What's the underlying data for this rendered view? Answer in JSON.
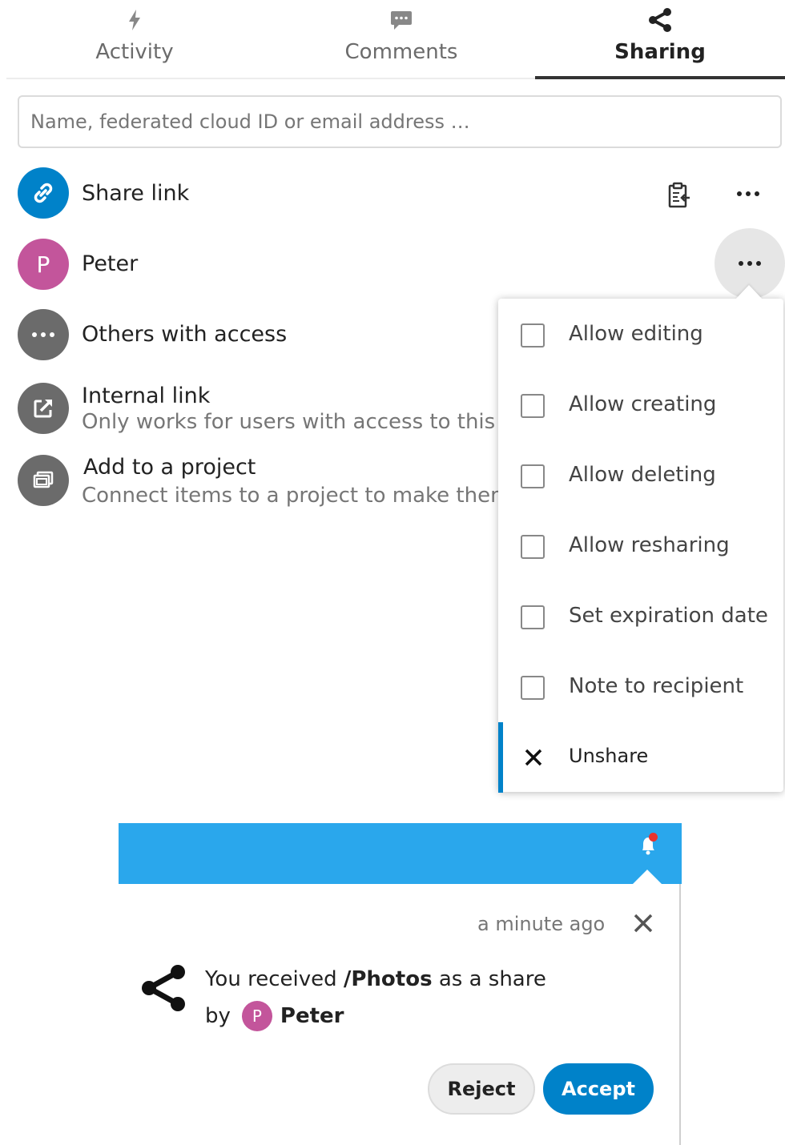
{
  "tabs": [
    {
      "label": "Activity",
      "icon": "lightning-icon",
      "active": false
    },
    {
      "label": "Comments",
      "icon": "comment-icon",
      "active": false
    },
    {
      "label": "Sharing",
      "icon": "share-icon",
      "active": true
    }
  ],
  "search": {
    "placeholder": "Name, federated cloud ID or email address …",
    "value": ""
  },
  "shares": {
    "share_link": {
      "title": "Share link",
      "icon": "link-icon",
      "avatar_color": "#0082c9"
    },
    "peter": {
      "initial": "P",
      "title": "Peter",
      "avatar_color": "#c3559b"
    },
    "others": {
      "title": "Others with access",
      "icon": "more-icon",
      "avatar_color": "#6b6b6b"
    },
    "internal_link": {
      "title": "Internal link",
      "subtitle": "Only works for users with access to this fo",
      "icon": "external-link-icon",
      "avatar_color": "#6b6b6b"
    },
    "project": {
      "title": "Add to a project",
      "subtitle": "Connect items to a project to make them",
      "icon": "project-icon",
      "avatar_color": "#6b6b6b"
    }
  },
  "menu": {
    "items": [
      {
        "label": "Allow editing",
        "checked": false
      },
      {
        "label": "Allow creating",
        "checked": false
      },
      {
        "label": "Allow deleting",
        "checked": false
      },
      {
        "label": "Allow resharing",
        "checked": false
      },
      {
        "label": "Set expiration date",
        "checked": false
      },
      {
        "label": "Note to recipient",
        "checked": false
      }
    ],
    "unshare": "Unshare"
  },
  "notification": {
    "time": "a minute ago",
    "message_prefix": "You received",
    "message_path": "/Photos",
    "message_suffix": "as a share",
    "by": "by",
    "user_initial": "P",
    "user_name": "Peter",
    "reject": "Reject",
    "accept": "Accept",
    "header_color": "#2aa7ec",
    "accent": "#0082c9",
    "badge_color": "#e9322d"
  }
}
